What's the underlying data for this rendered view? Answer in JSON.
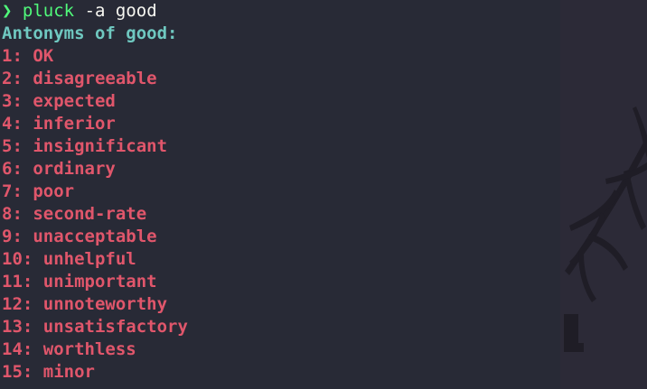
{
  "prompt": {
    "symbol": "❯",
    "command": "pluck",
    "args": "-a good"
  },
  "output": {
    "header": "Antonyms of good:",
    "items": [
      "1: OK",
      "2: disagreeable",
      "3: expected",
      "4: inferior",
      "5: insignificant",
      "6: ordinary",
      "7: poor",
      "8: second-rate",
      "9: unacceptable",
      "10: unhelpful",
      "11: unimportant",
      "12: unnoteworthy",
      "13: unsatisfactory",
      "14: worthless",
      "15: minor"
    ]
  },
  "colors": {
    "background": "#282a36",
    "prompt": "#50fa7b",
    "header": "#6fc8c0",
    "items": "#e0566b"
  }
}
